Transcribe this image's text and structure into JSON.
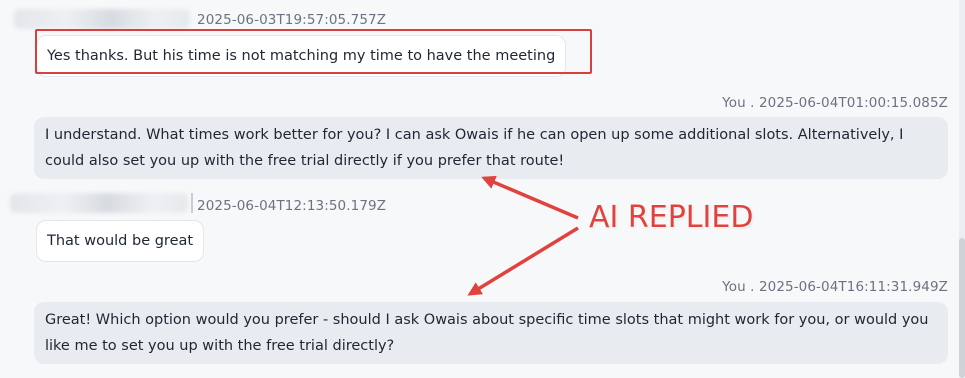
{
  "messages": [
    {
      "sender": "",
      "timestamp": "2025-06-03T19:57:05.757Z",
      "text": "Yes thanks. But his time is not matching my time to have the meeting"
    },
    {
      "sender": "You",
      "separator": ".",
      "timestamp": "2025-06-04T01:00:15.085Z",
      "text": "I understand. What times work better for you? I can ask Owais if he can open up some additional slots. Alternatively, I could also set you up with the free trial directly if you prefer that route!"
    },
    {
      "sender": "",
      "timestamp": "2025-06-04T12:13:50.179Z",
      "text": "That would be great"
    },
    {
      "sender": "You",
      "separator": ".",
      "timestamp": "2025-06-04T16:11:31.949Z",
      "text": "Great! Which option would you prefer - should I ask Owais about specific time slots that might work for you, or would you like me to set you up with the free trial directly?"
    }
  ],
  "annotation": {
    "label": "AI REPLIED",
    "color": "#e0433e"
  },
  "colors": {
    "incoming_bubble": "#ffffff",
    "outgoing_bubble": "#e8ebf0",
    "highlight": "#d64040",
    "meta_text": "#6b7280"
  }
}
